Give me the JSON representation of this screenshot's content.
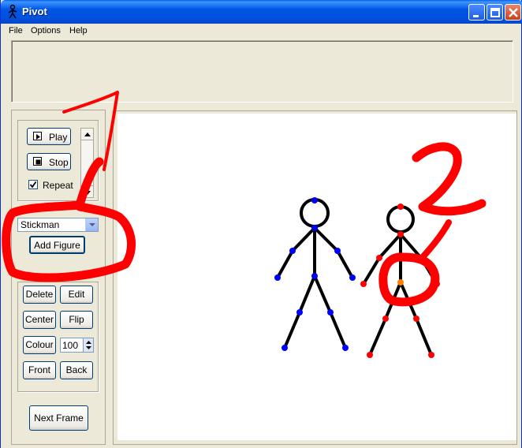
{
  "window": {
    "title": "Pivot"
  },
  "menu": {
    "items": [
      "File",
      "Options",
      "Help"
    ]
  },
  "playback": {
    "play_label": "Play",
    "stop_label": "Stop",
    "repeat_label": "Repeat",
    "repeat_checked": true
  },
  "figure": {
    "select_value": "Stickman",
    "add_label": "Add Figure",
    "delete_label": "Delete",
    "edit_label": "Edit",
    "center_label": "Center",
    "flip_label": "Flip",
    "colour_label": "Colour",
    "thickness_value": "100",
    "front_label": "Front",
    "back_label": "Back"
  },
  "frame": {
    "next_label": "Next Frame"
  },
  "colors": {
    "titlebar": "#0055E5",
    "joint_blue": "#0000FF",
    "joint_red": "#FF0000",
    "joint_orange": "#FF8000",
    "annotation_red": "#FF0000"
  }
}
